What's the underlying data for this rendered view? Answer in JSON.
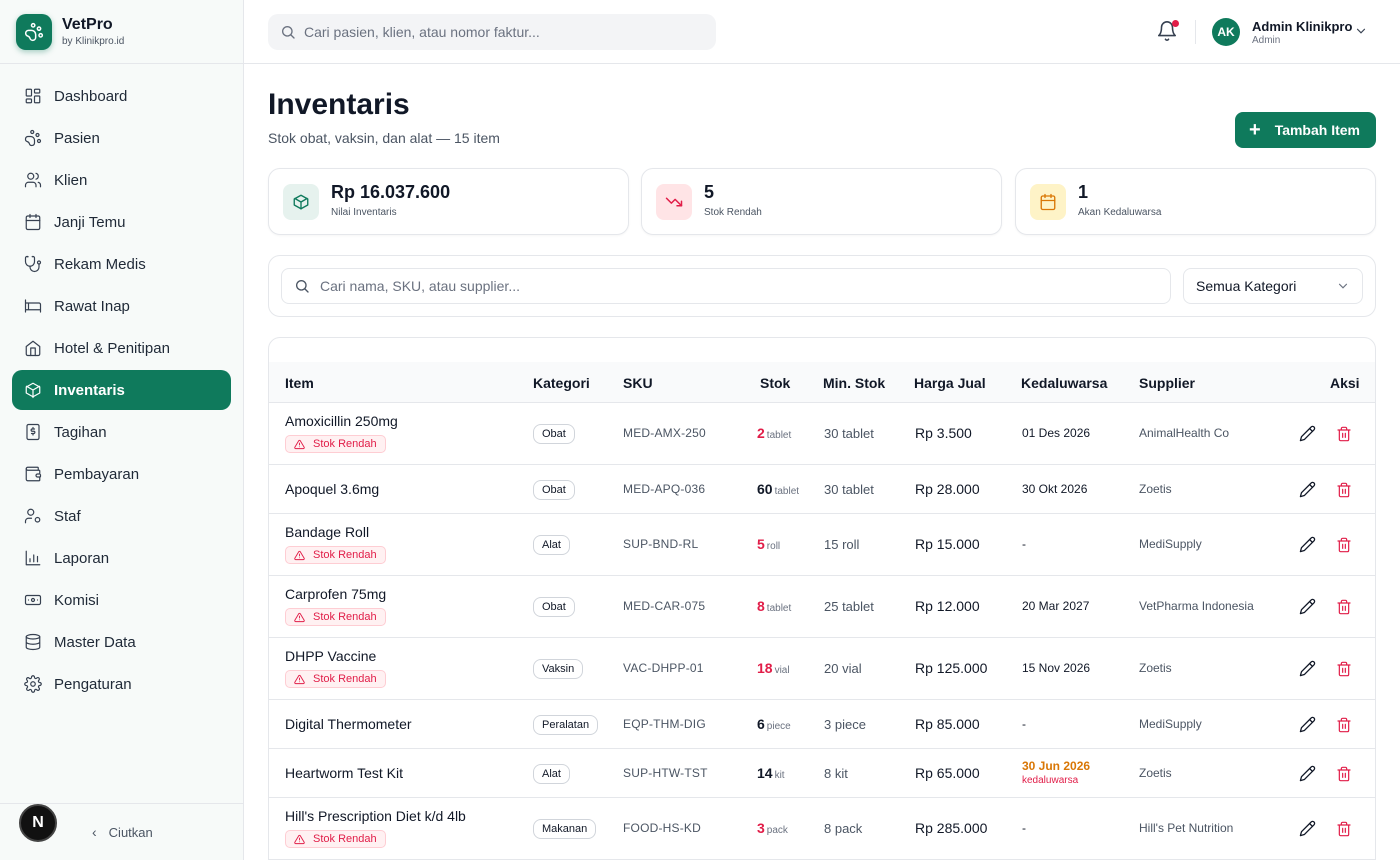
{
  "brand": {
    "name": "VetPro",
    "sub": "by Klinikpro.id"
  },
  "sidebar": {
    "items": [
      {
        "label": "Dashboard",
        "icon": "dashboard-icon"
      },
      {
        "label": "Pasien",
        "icon": "paw-icon"
      },
      {
        "label": "Klien",
        "icon": "users-icon"
      },
      {
        "label": "Janji Temu",
        "icon": "calendar-icon"
      },
      {
        "label": "Rekam Medis",
        "icon": "stethoscope-icon"
      },
      {
        "label": "Rawat Inap",
        "icon": "bed-icon"
      },
      {
        "label": "Hotel & Penitipan",
        "icon": "home-icon"
      },
      {
        "label": "Inventaris",
        "icon": "box-icon",
        "active": true
      },
      {
        "label": "Tagihan",
        "icon": "invoice-icon"
      },
      {
        "label": "Pembayaran",
        "icon": "wallet-icon"
      },
      {
        "label": "Staf",
        "icon": "user-cog-icon"
      },
      {
        "label": "Laporan",
        "icon": "bar-chart-icon"
      },
      {
        "label": "Komisi",
        "icon": "banknote-icon"
      },
      {
        "label": "Master Data",
        "icon": "database-icon"
      },
      {
        "label": "Pengaturan",
        "icon": "gear-icon"
      }
    ],
    "collapse_label": "Ciutkan",
    "badge_letter": "N"
  },
  "topbar": {
    "search_placeholder": "Cari pasien, klien, atau nomor faktur...",
    "user": {
      "initials": "AK",
      "name": "Admin Klinikpro",
      "role": "Admin"
    }
  },
  "page": {
    "title": "Inventaris",
    "subtitle": "Stok obat, vaksin, dan alat — 15 item",
    "add_button": "Tambah Item"
  },
  "stats": [
    {
      "value": "Rp 16.037.600",
      "label": "Nilai Inventaris",
      "icon": "box-icon",
      "color": "#0f7a5c"
    },
    {
      "value": "5",
      "label": "Stok Rendah",
      "icon": "trending-down-icon",
      "color": "#e11d48"
    },
    {
      "value": "1",
      "label": "Akan Kedaluwarsa",
      "icon": "calendar-icon",
      "color": "#d97706"
    }
  ],
  "filter": {
    "search_placeholder": "Cari nama, SKU, atau supplier...",
    "category_value": "Semua Kategori"
  },
  "table": {
    "headers": [
      "Item",
      "Kategori",
      "SKU",
      "Stok",
      "Min. Stok",
      "Harga Jual",
      "Kedaluwarsa",
      "Supplier",
      "Aksi"
    ],
    "low_badge": "Stok Rendah",
    "rows": [
      {
        "name": "Amoxicillin 250mg",
        "low": true,
        "category": "Obat",
        "sku": "MED-AMX-250",
        "stock": "2",
        "unit": "tablet",
        "min": "30 tablet",
        "price": "Rp 3.500",
        "expiry": "01 Des 2026",
        "expiry_note": "",
        "supplier": "AnimalHealth Co"
      },
      {
        "name": "Apoquel 3.6mg",
        "low": false,
        "category": "Obat",
        "sku": "MED-APQ-036",
        "stock": "60",
        "unit": "tablet",
        "min": "30 tablet",
        "price": "Rp 28.000",
        "expiry": "30 Okt 2026",
        "expiry_note": "",
        "supplier": "Zoetis"
      },
      {
        "name": "Bandage Roll",
        "low": true,
        "category": "Alat",
        "sku": "SUP-BND-RL",
        "stock": "5",
        "unit": "roll",
        "min": "15 roll",
        "price": "Rp 15.000",
        "expiry": "-",
        "expiry_note": "",
        "supplier": "MediSupply"
      },
      {
        "name": "Carprofen 75mg",
        "low": true,
        "category": "Obat",
        "sku": "MED-CAR-075",
        "stock": "8",
        "unit": "tablet",
        "min": "25 tablet",
        "price": "Rp 12.000",
        "expiry": "20 Mar 2027",
        "expiry_note": "",
        "supplier": "VetPharma Indonesia"
      },
      {
        "name": "DHPP Vaccine",
        "low": true,
        "category": "Vaksin",
        "sku": "VAC-DHPP-01",
        "stock": "18",
        "unit": "vial",
        "min": "20 vial",
        "price": "Rp 125.000",
        "expiry": "15 Nov 2026",
        "expiry_note": "",
        "supplier": "Zoetis"
      },
      {
        "name": "Digital Thermometer",
        "low": false,
        "category": "Peralatan",
        "sku": "EQP-THM-DIG",
        "stock": "6",
        "unit": "piece",
        "min": "3 piece",
        "price": "Rp 85.000",
        "expiry": "-",
        "expiry_note": "",
        "supplier": "MediSupply"
      },
      {
        "name": "Heartworm Test Kit",
        "low": false,
        "category": "Alat",
        "sku": "SUP-HTW-TST",
        "stock": "14",
        "unit": "kit",
        "min": "8 kit",
        "price": "Rp 65.000",
        "expiry": "30 Jun 2026",
        "expiry_note": "kedaluwarsa",
        "supplier": "Zoetis"
      },
      {
        "name": "Hill's Prescription Diet k/d 4lb",
        "low": true,
        "category": "Makanan",
        "sku": "FOOD-HS-KD",
        "stock": "3",
        "unit": "pack",
        "min": "8 pack",
        "price": "Rp 285.000",
        "expiry": "-",
        "expiry_note": "",
        "supplier": "Hill's Pet Nutrition"
      }
    ]
  }
}
